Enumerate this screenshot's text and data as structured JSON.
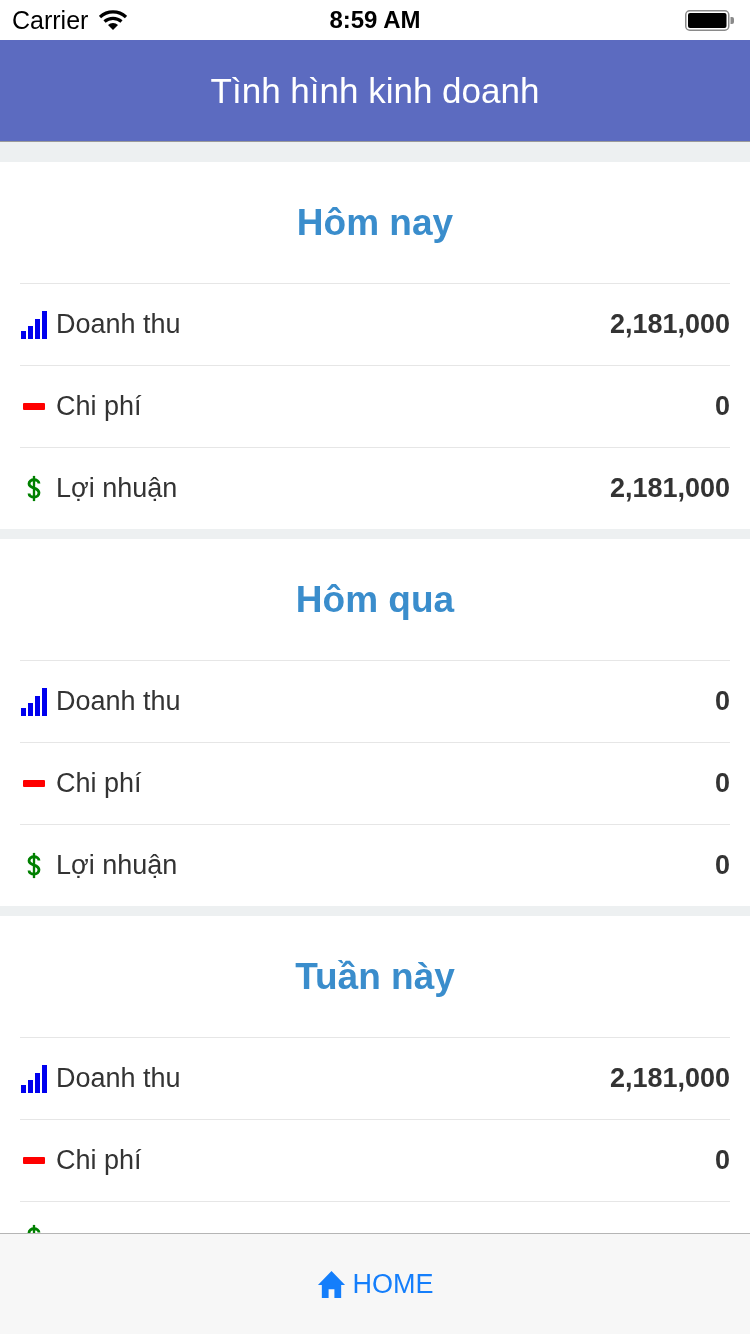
{
  "status_bar": {
    "carrier": "Carrier",
    "time": "8:59 AM"
  },
  "header": {
    "title": "Tình hình kinh doanh"
  },
  "sections": [
    {
      "title": "Hôm nay",
      "rows": [
        {
          "kind": "revenue",
          "label": "Doanh thu",
          "value": "2,181,000"
        },
        {
          "kind": "expense",
          "label": "Chi phí",
          "value": "0"
        },
        {
          "kind": "profit",
          "label": "Lợi nhuận",
          "value": "2,181,000"
        }
      ]
    },
    {
      "title": "Hôm qua",
      "rows": [
        {
          "kind": "revenue",
          "label": "Doanh thu",
          "value": "0"
        },
        {
          "kind": "expense",
          "label": "Chi phí",
          "value": "0"
        },
        {
          "kind": "profit",
          "label": "Lợi nhuận",
          "value": "0"
        }
      ]
    },
    {
      "title": "Tuần này",
      "rows": [
        {
          "kind": "revenue",
          "label": "Doanh thu",
          "value": "2,181,000"
        },
        {
          "kind": "expense",
          "label": "Chi phí",
          "value": "0"
        },
        {
          "kind": "profit",
          "cut_off": true
        }
      ]
    }
  ],
  "tab_bar": {
    "items": [
      {
        "label": "HOME",
        "selected": true
      }
    ]
  }
}
